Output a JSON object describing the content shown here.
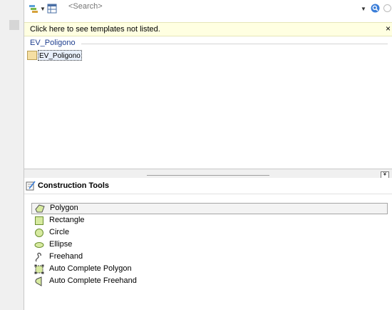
{
  "search": {
    "placeholder": "<Search>"
  },
  "infobar": {
    "message": "Click here to see templates not listed.",
    "close_glyph": "×"
  },
  "templates": {
    "group_header": "EV_Poligono",
    "items": [
      {
        "label": "EV_Poligono",
        "swatch_color": "#f5dfa3"
      }
    ]
  },
  "construction_tools": {
    "title": "Construction Tools",
    "tools": [
      {
        "label": "Polygon",
        "icon": "polygon-icon",
        "selected": true
      },
      {
        "label": "Rectangle",
        "icon": "rectangle-icon"
      },
      {
        "label": "Circle",
        "icon": "circle-icon"
      },
      {
        "label": "Ellipse",
        "icon": "ellipse-icon"
      },
      {
        "label": "Freehand",
        "icon": "freehand-icon"
      },
      {
        "label": "Auto Complete Polygon",
        "icon": "auto-complete-polygon-icon"
      },
      {
        "label": "Auto Complete Freehand",
        "icon": "auto-complete-freehand-icon"
      }
    ]
  },
  "colors": {
    "infobar_bg": "#ffffe1",
    "group_header": "#1f3f8f",
    "shape_fill": "#d7eaa0"
  }
}
